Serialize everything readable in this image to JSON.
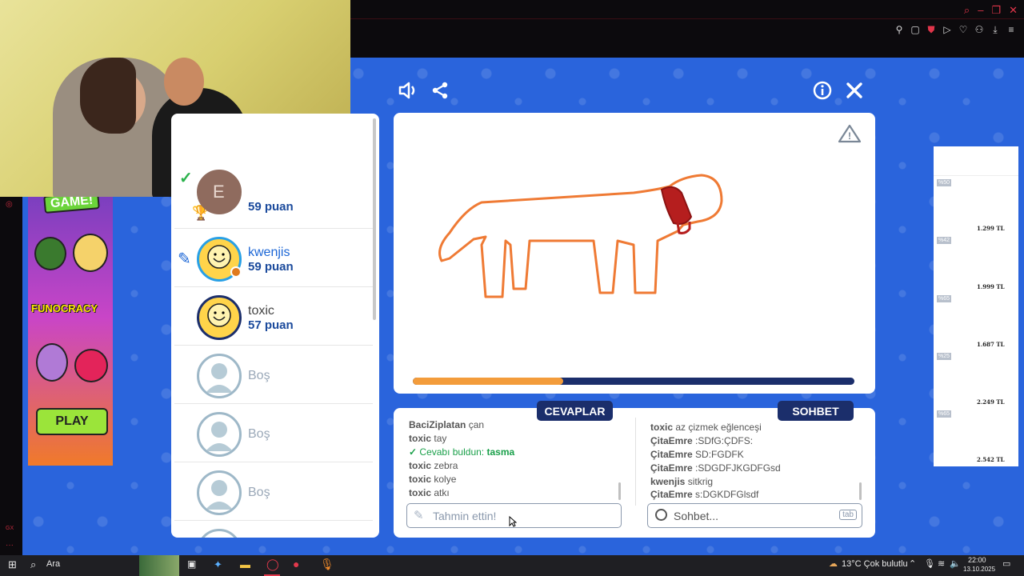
{
  "browser": {
    "window_controls": [
      "search-icon",
      "minimize-icon",
      "maximize-icon",
      "close-icon"
    ]
  },
  "game": {
    "players": [
      {
        "name": "",
        "points": "59 puan",
        "avatar": "E"
      },
      {
        "name": "kwenjis",
        "points": "59 puan"
      },
      {
        "name": "toxic",
        "points": "57 puan"
      },
      {
        "name": "Boş"
      },
      {
        "name": "Boş"
      },
      {
        "name": "Boş"
      }
    ],
    "progress": 0.34,
    "answers_tab": "CEVAPLAR",
    "chat_tab": "SOHBET",
    "answers": [
      {
        "user": "BaciZiplatan",
        "text": "çan"
      },
      {
        "user": "toxic",
        "text": "tay"
      },
      {
        "found_label": "Cevabı buldun:",
        "word": "tasma"
      },
      {
        "user": "toxic",
        "text": "zebra"
      },
      {
        "user": "toxic",
        "text": "kolye"
      },
      {
        "user": "toxic",
        "text": "atkı"
      }
    ],
    "chat": [
      {
        "user": "toxic",
        "text": "az çizmek eğlenceşi"
      },
      {
        "user": "ÇitaEmre",
        "text": ":SDfG:ÇDFS:"
      },
      {
        "user": "ÇitaEmre",
        "text": "SD:FGDFK"
      },
      {
        "user": "ÇitaEmre",
        "text": ":SDGDFJKGDFGsd"
      },
      {
        "user": "kwenjis",
        "text": "sitkrig"
      },
      {
        "user": "ÇitaEmre",
        "text": "s:DGKDFGlsdf"
      }
    ],
    "guess_placeholder": "Tahmin ettin!",
    "chat_placeholder": "Sohbet...",
    "tab_hint": "tab"
  },
  "ad_left": {
    "logo": "FUNOCRACY",
    "button": "PLAY",
    "top_text": "GAME!"
  },
  "ad_right": {
    "items": [
      {
        "tag": "%50",
        "price": "1.299 TL"
      },
      {
        "tag": "%42",
        "price": "1.999 TL"
      },
      {
        "tag": "%65",
        "price": "1.687 TL"
      },
      {
        "tag": "%25",
        "price": "2.249 TL"
      },
      {
        "tag": "%65",
        "price": "2.542 TL"
      }
    ]
  },
  "taskbar": {
    "search": "Ara",
    "weather": "13°C  Çok bulutlu",
    "time": "22:00",
    "date": "13.10.2025"
  }
}
